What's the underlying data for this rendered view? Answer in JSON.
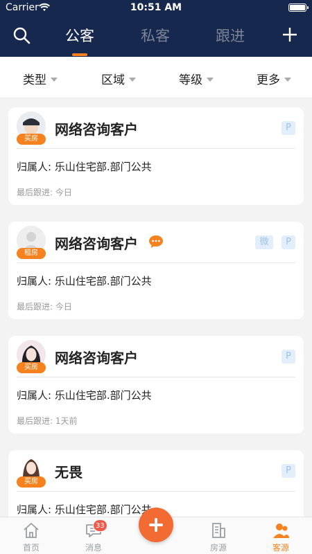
{
  "status": {
    "carrier": "Carrier",
    "time": "10:51 AM"
  },
  "nav": {
    "tabs": [
      {
        "label": "公客"
      },
      {
        "label": "私客"
      },
      {
        "label": "跟进"
      }
    ]
  },
  "filters": [
    {
      "label": "类型"
    },
    {
      "label": "区域"
    },
    {
      "label": "等级"
    },
    {
      "label": "更多"
    }
  ],
  "cards": [
    {
      "title": "网络咨询客户",
      "tag": "买房",
      "owner": "归属人: 乐山住宅部.部门公共",
      "follow": "最后跟进: 今日",
      "badge_p": "P",
      "badge_wei": ""
    },
    {
      "title": "网络咨询客户",
      "tag": "租房",
      "owner": "归属人: 乐山住宅部.部门公共",
      "follow": "最后跟进: 今日",
      "badge_p": "P",
      "badge_wei": "微"
    },
    {
      "title": "网络咨询客户",
      "tag": "买房",
      "owner": "归属人: 乐山住宅部.部门公共",
      "follow": "最后跟进: 1天前",
      "badge_p": "P",
      "badge_wei": ""
    },
    {
      "title": "无畏",
      "tag": "买房",
      "owner": "归属人: 乐山住宅部.部门公共",
      "follow": "",
      "badge_p": "P",
      "badge_wei": ""
    }
  ],
  "tabbar": {
    "items": [
      {
        "label": "首页"
      },
      {
        "label": "消息",
        "badge": "33"
      },
      {
        "label": "房源"
      },
      {
        "label": "客源"
      }
    ]
  },
  "colors": {
    "header": "#17284f",
    "accent": "#f5821f",
    "fab": "#f26b32"
  }
}
